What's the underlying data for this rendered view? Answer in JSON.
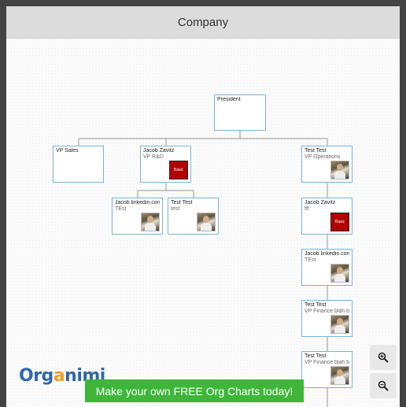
{
  "chart": {
    "title": "Company"
  },
  "nodes": {
    "president": {
      "name": "President",
      "title": ""
    },
    "vp_sales": {
      "name": "VP Sales",
      "title": ""
    },
    "jacob_rd": {
      "name": "Jacob Zavitz",
      "title": "VP R&D",
      "badge": "Basic"
    },
    "test_ops": {
      "name": "Test Test",
      "title": "VP Operations"
    },
    "jacob_linkedin_1": {
      "name": "Jacob linkedin.con",
      "title": "TEst"
    },
    "test_test": {
      "name": "Test Test",
      "title": "test"
    },
    "jacob_fff": {
      "name": "Jacob Zavitz",
      "title": "fff",
      "badge": "Basic"
    },
    "jacob_linkedin_2": {
      "name": "Jacob linkedin.con",
      "title": "TEst"
    },
    "test_fin_1": {
      "name": "Test Test",
      "title": "VP Finance blah bla"
    },
    "test_fin_2": {
      "name": "Test Test",
      "title": "VP Finance blah bla"
    }
  },
  "branding": {
    "logo_left": "Org",
    "logo_mid": "a",
    "logo_right": "nimi",
    "cta": "Make your own FREE Org Charts today!"
  },
  "icons": {
    "zoom_in": "zoom-in-icon",
    "zoom_out": "zoom-out-icon"
  }
}
